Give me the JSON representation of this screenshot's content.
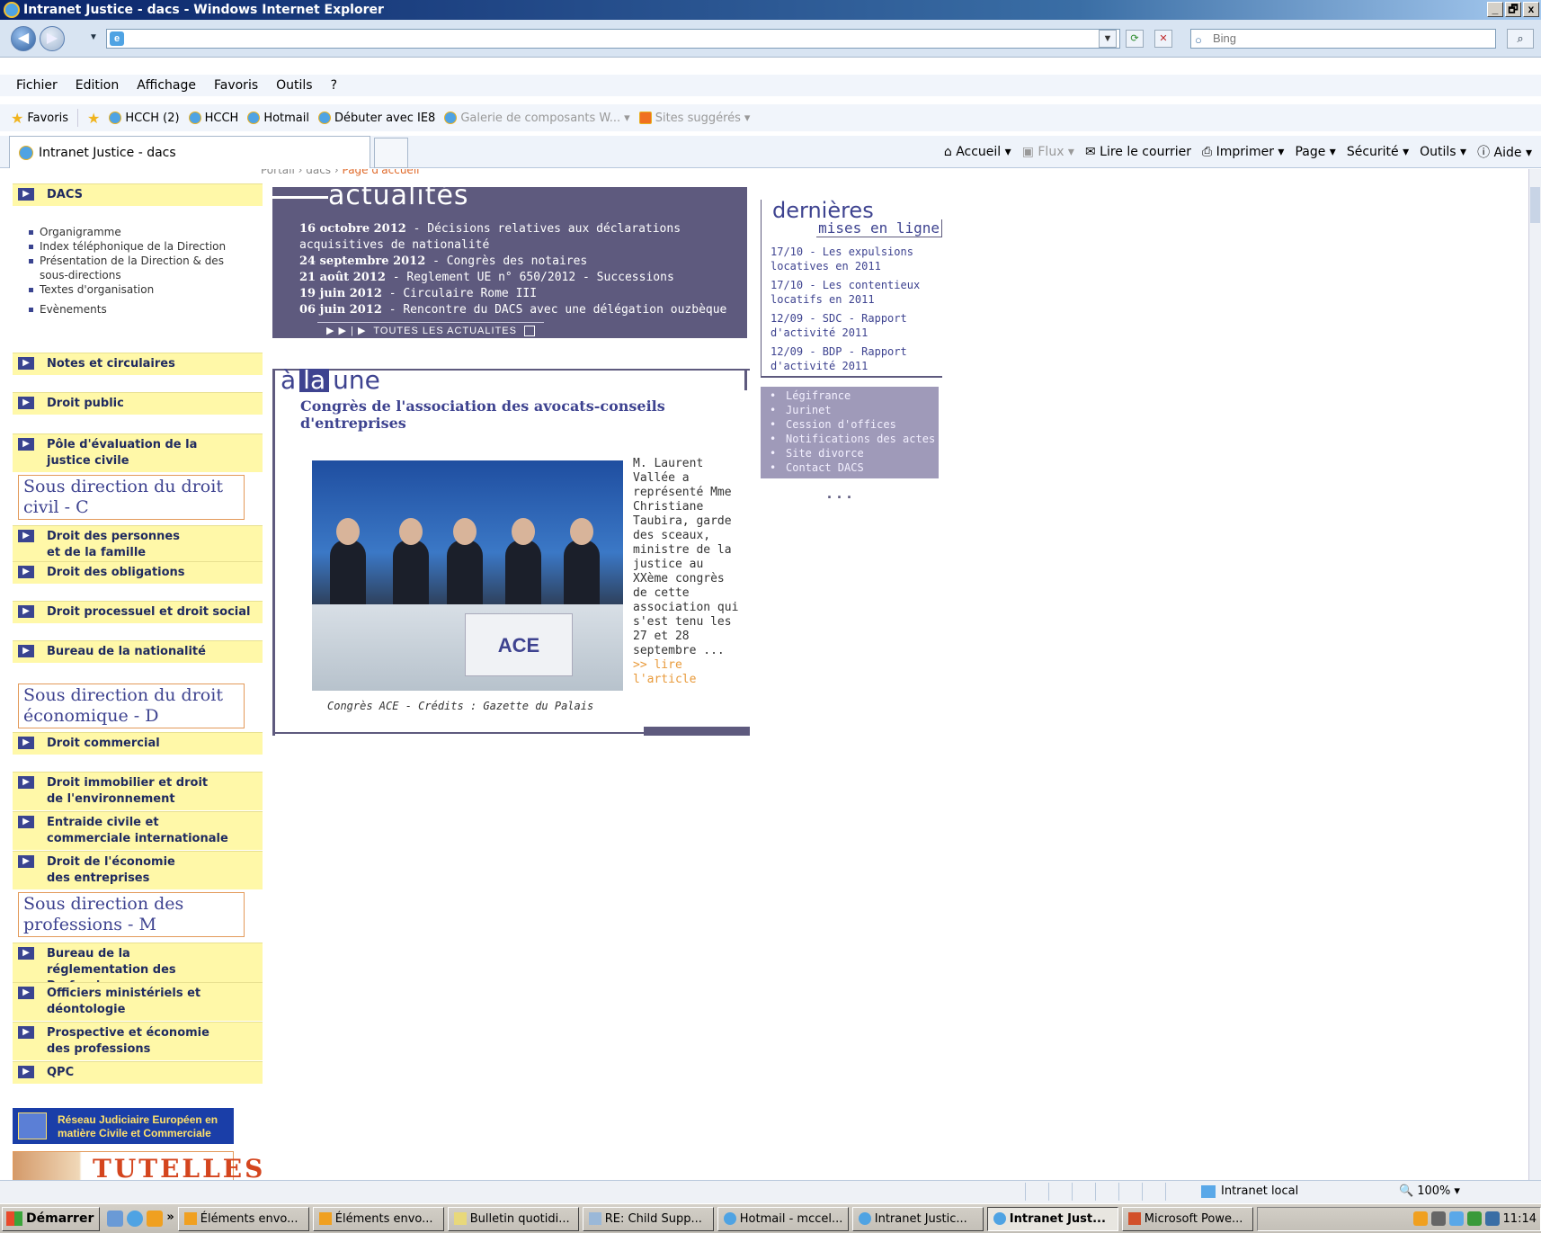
{
  "window": {
    "title": "Intranet Justice - dacs - Windows Internet Explorer",
    "buttons": [
      "_",
      "🗗",
      "x"
    ]
  },
  "address": {
    "url": "",
    "search_placeholder": "Bing"
  },
  "menu": [
    "Fichier",
    "Edition",
    "Affichage",
    "Favoris",
    "Outils",
    "?"
  ],
  "favorites": {
    "label": "Favoris",
    "items": [
      "HCCH (2)",
      "HCCH",
      "Hotmail",
      "Débuter avec IE8",
      "Galerie de composants W...",
      "Sites suggérés"
    ]
  },
  "tab": {
    "title": "Intranet Justice - dacs"
  },
  "commands": [
    "Accueil",
    "Flux",
    "Lire le courrier",
    "Imprimer",
    "Page",
    "Sécurité",
    "Outils",
    "Aide"
  ],
  "page": {
    "breadcrumb": {
      "path": "Portail › dacs ›",
      "current": "Page d'accueil"
    },
    "nav": {
      "dacs": "DACS",
      "dacs_links": [
        "Organigramme",
        "Index téléphonique de la Direction",
        "Présentation de la Direction & des sous-directions",
        "Textes d'organisation"
      ],
      "evenements": "Evènements",
      "notes": "Notes et circulaires",
      "droit_public": "Droit public",
      "pole": "Pôle d'évaluation de la justice civile",
      "sd_c": "Sous direction du droit civil - C",
      "c_items": [
        "Droit des personnes et de la famille",
        "Droit des obligations",
        "Droit processuel et droit social",
        "Bureau de la nationalité"
      ],
      "sd_d": "Sous direction du droit économique - D",
      "d_items": [
        "Droit commercial",
        "Droit immobilier et droit de l'environnement",
        "Entraide civile et commerciale internationale",
        "Droit de l'économie des entreprises"
      ],
      "sd_m": "Sous direction des professions - M",
      "m_items": [
        "Bureau de la réglementation des Professions",
        "Officiers ministériels et déontologie",
        "Prospective et économie des professions",
        "QPC"
      ],
      "rje": "Réseau Judiciaire Européen en matière Civile et Commerciale",
      "tutelles": "TUTELLES"
    },
    "actualites": {
      "title": "actualités",
      "items": [
        {
          "date": "16 octobre 2012",
          "text": " - Décisions relatives aux déclarations acquisitives de nationalité"
        },
        {
          "date": "24 septembre 2012",
          "text": " - Congrès des notaires"
        },
        {
          "date": "21 août 2012",
          "text": " - Reglement UE n° 650/2012 - Successions"
        },
        {
          "date": "19 juin 2012",
          "text": " - Circulaire Rome III"
        },
        {
          "date": "06 juin 2012",
          "text": " - Rencontre du DACS avec une délégation ouzbèque"
        }
      ],
      "all_link": "TOUTES LES ACTUALITES"
    },
    "alaune": {
      "heading_a": "à",
      "heading_la": "la",
      "heading_une": "une",
      "article_title": "Congrès de l'association des avocats-conseils d'entreprises",
      "snippet": "M. Laurent Vallée a représenté Mme Christiane Taubira, garde des sceaux, ministre de la justice au XXème congrès de cette association qui s'est tenu les 27 et 28 septembre ...",
      "read_more": ">> lire l'article",
      "caption": "Congrès ACE - Crédits : Gazette du Palais",
      "banner_text": "ACE"
    },
    "dernieres": {
      "title": "dernières",
      "subtitle": "mises en ligne",
      "items": [
        "17/10 - Les expulsions locatives en 2011",
        "17/10 - Les contentieux locatifs en 2011",
        "12/09 - SDC - Rapport d'activité 2011",
        "12/09 - BDP - Rapport d'activité 2011"
      ]
    },
    "links": [
      "Légifrance",
      "Jurinet",
      "Cession d'offices",
      "Notifications des actes",
      "Site divorce",
      "Contact DACS"
    ],
    "dots": "..."
  },
  "status": {
    "zone": "Intranet local",
    "zoom": "100%"
  },
  "taskbar": {
    "start": "Démarrer",
    "chevron": "»",
    "buttons": [
      "Éléments envo...",
      "Éléments envo...",
      "Bulletin quotidi...",
      "RE: Child Supp...",
      "Hotmail - mccel...",
      "Intranet Justic...",
      "Intranet Just...",
      "Microsoft Powe..."
    ],
    "clock": "11:14"
  }
}
